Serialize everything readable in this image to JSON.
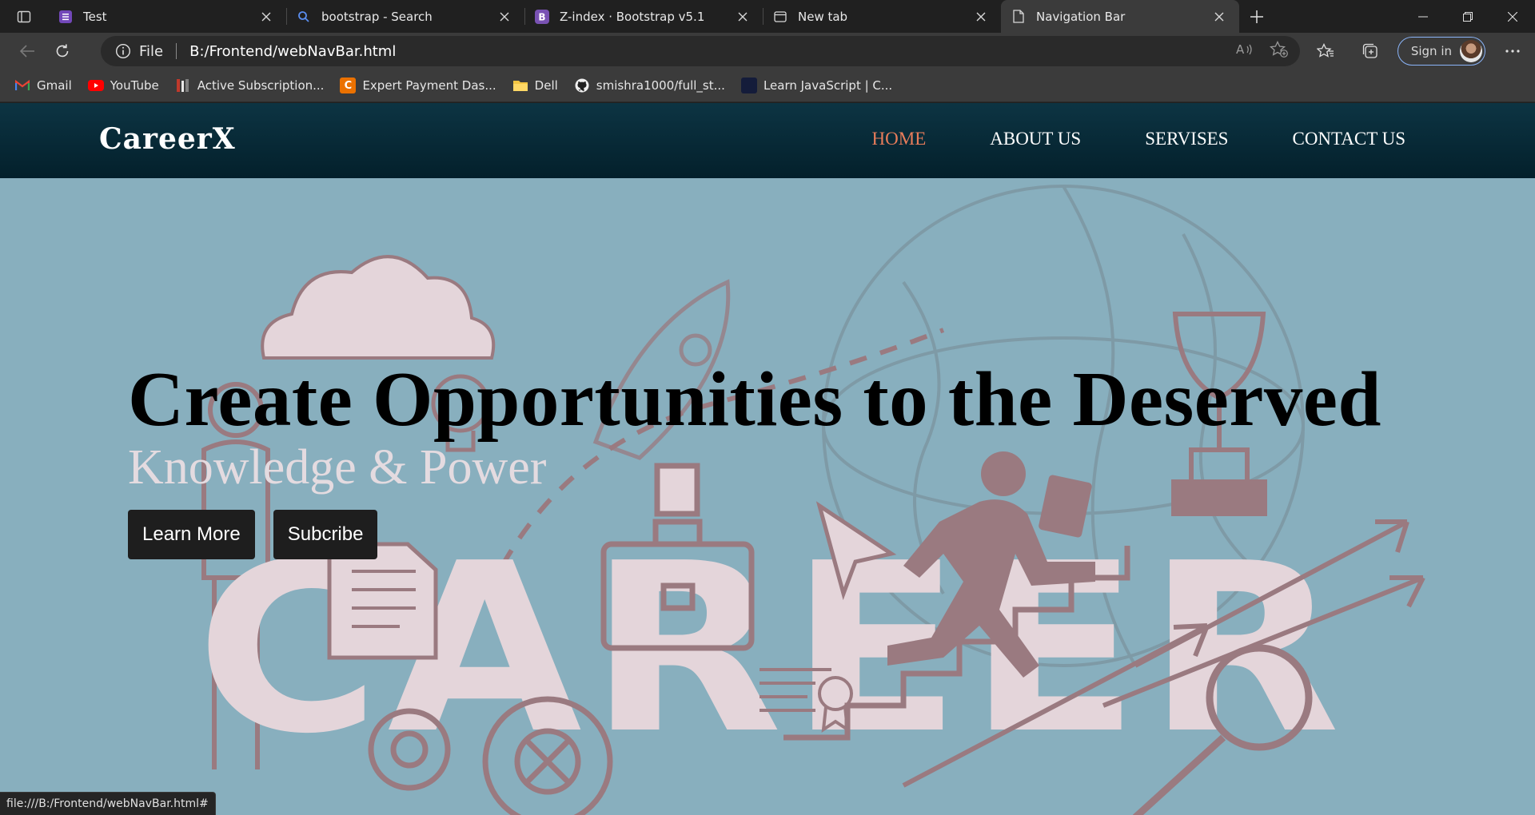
{
  "browser": {
    "tabs": [
      {
        "title": "Test",
        "icon": "forms-icon",
        "active": false
      },
      {
        "title": "bootstrap - Search",
        "icon": "search-icon",
        "active": false
      },
      {
        "title": "Z-index · Bootstrap v5.1",
        "icon": "bootstrap-icon",
        "active": false
      },
      {
        "title": "New tab",
        "icon": "newtab-icon",
        "active": false
      },
      {
        "title": "Navigation Bar",
        "icon": "file-icon",
        "active": true
      }
    ],
    "address": {
      "scheme_label": "File",
      "url": "B:/Frontend/webNavBar.html"
    },
    "signin_label": "Sign in",
    "bookmarks": [
      {
        "label": "Gmail",
        "icon": "gmail-icon"
      },
      {
        "label": "YouTube",
        "icon": "youtube-icon"
      },
      {
        "label": "Active Subscription...",
        "icon": "site-icon"
      },
      {
        "label": "Expert Payment Das...",
        "icon": "chegg-icon"
      },
      {
        "label": "Dell",
        "icon": "folder-icon"
      },
      {
        "label": "smishra1000/full_st...",
        "icon": "github-icon"
      },
      {
        "label": "Learn JavaScript | C...",
        "icon": "codecademy-icon"
      }
    ],
    "status_url": "file:///B:/Frontend/webNavBar.html#"
  },
  "site": {
    "logo": "CareerX",
    "nav": [
      {
        "label": "HOME",
        "active": true
      },
      {
        "label": "ABOUT US",
        "active": false
      },
      {
        "label": "SERVISES",
        "active": false
      },
      {
        "label": "CONTACT US",
        "active": false
      }
    ],
    "hero": {
      "headline": "Create Opportunities to the Deserved",
      "subline": "Knowledge & Power",
      "buttons": [
        "Learn More",
        "Subcribe"
      ],
      "background_word": "CAREER"
    }
  },
  "colors": {
    "nav_bg": "#03202b",
    "nav_active": "#e87c5a",
    "hero_bg": "#88afbe",
    "art_light": "#e4d5da",
    "art_dark": "#9a7a80",
    "button_bg": "#1e1e1e"
  }
}
